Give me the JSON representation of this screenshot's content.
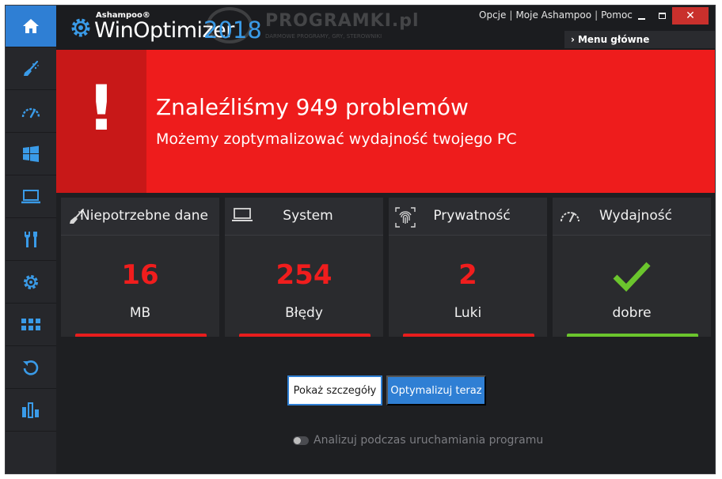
{
  "app": {
    "brand_small": "Ashampoo®",
    "brand_name": "WinOptimizer",
    "brand_year": "2018",
    "watermark_title": "PROGRAMKI.pl",
    "watermark_sub": "DARMOWE PROGRAMY, GRY, STEROWNIKI"
  },
  "top_links": [
    {
      "label": "Opcje"
    },
    {
      "label": "Moje Ashampoo"
    },
    {
      "label": "Pomoc"
    }
  ],
  "window_controls": {
    "close": "✕"
  },
  "menu_main": {
    "label": "Menu główne",
    "chevron": "›"
  },
  "sidebar": {
    "items": [
      {
        "icon": "home-icon",
        "active": true
      },
      {
        "icon": "broom-icon",
        "active": false
      },
      {
        "icon": "speedometer-icon",
        "active": false
      },
      {
        "icon": "windows-icon",
        "active": false
      },
      {
        "icon": "laptop-icon",
        "active": false
      },
      {
        "icon": "tools-icon",
        "active": false
      },
      {
        "icon": "gear-icon",
        "active": false
      },
      {
        "icon": "grid-icon",
        "active": false
      },
      {
        "icon": "restore-icon",
        "active": false
      },
      {
        "icon": "bar-chart-icon",
        "active": false
      }
    ]
  },
  "banner": {
    "alert": "!",
    "headline": "Znaleźliśmy 949 problemów",
    "subline": "Możemy zoptymalizować wydajność twojego PC"
  },
  "cards": [
    {
      "title": "Niepotrzebne dane",
      "value": "16",
      "unit": "MB",
      "icon": "broom-icon",
      "status": "problem"
    },
    {
      "title": "System",
      "value": "254",
      "unit": "Błędy",
      "icon": "laptop-icon",
      "status": "problem"
    },
    {
      "title": "Prywatność",
      "value": "2",
      "unit": "Luki",
      "icon": "fingerprint-icon",
      "status": "problem"
    },
    {
      "title": "Wydajność",
      "value": "",
      "unit": "dobre",
      "icon": "speedometer-icon",
      "status": "ok"
    }
  ],
  "actions": {
    "details_label": "Pokaż szczegóły",
    "optimize_label": "Optymalizuj teraz"
  },
  "startup_toggle": {
    "label": "Analizuj podczas uruchamiania programu",
    "enabled": false
  },
  "colors": {
    "accent": "#2f7fd4",
    "alert_red": "#ee1c1c",
    "value_red": "#f01d1d",
    "ok_green": "#6bc52d",
    "year_blue": "#3a9be8"
  }
}
